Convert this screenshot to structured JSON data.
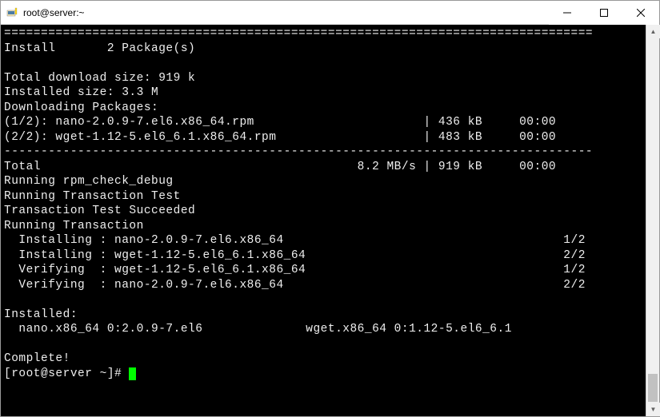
{
  "window": {
    "title": "root@server:~"
  },
  "terminal": {
    "sep_eq": "================================================================================",
    "sep_dash": "--------------------------------------------------------------------------------",
    "install_header": "Install       2 Package(s)",
    "blank": "",
    "total_download": "Total download size: 919 k",
    "installed_size": "Installed size: 3.3 M",
    "downloading": "Downloading Packages:",
    "pkg1": "(1/2): nano-2.0.9-7.el6.x86_64.rpm                       | 436 kB     00:00",
    "pkg2": "(2/2): wget-1.12-5.el6_6.1.x86_64.rpm                    | 483 kB     00:00",
    "total": "Total                                           8.2 MB/s | 919 kB     00:00",
    "rpm_check": "Running rpm_check_debug",
    "trans_test": "Running Transaction Test",
    "trans_succ": "Transaction Test Succeeded",
    "running_trans": "Running Transaction",
    "inst1": "  Installing : nano-2.0.9-7.el6.x86_64                                      1/2",
    "inst2": "  Installing : wget-1.12-5.el6_6.1.x86_64                                   2/2",
    "ver1": "  Verifying  : wget-1.12-5.el6_6.1.x86_64                                   1/2",
    "ver2": "  Verifying  : nano-2.0.9-7.el6.x86_64                                      2/2",
    "installed": "Installed:",
    "inst_pkgs": "  nano.x86_64 0:2.0.9-7.el6              wget.x86_64 0:1.12-5.el6_6.1",
    "complete": "Complete!",
    "prompt": "[root@server ~]# "
  }
}
